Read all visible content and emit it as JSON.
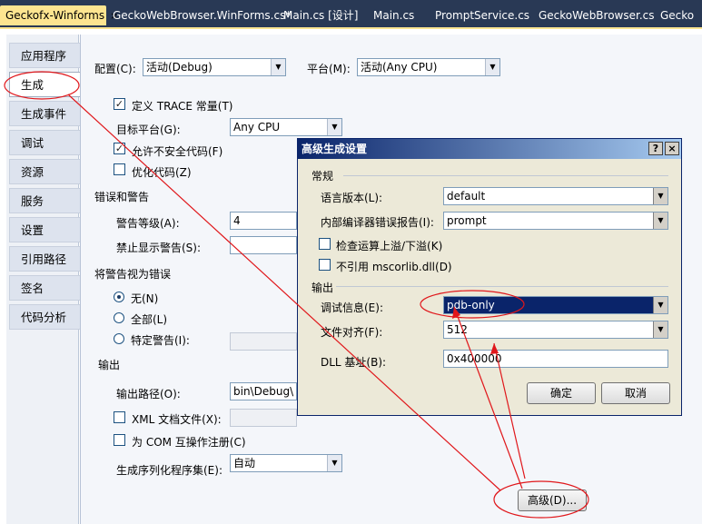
{
  "doc_tabs": [
    {
      "label": "Geckofx-Winforms",
      "active": true,
      "close": "×"
    },
    {
      "label": "GeckoWebBrowser.WinForms.cs*",
      "active": false
    },
    {
      "label": "Main.cs [设计]",
      "active": false
    },
    {
      "label": "Main.cs",
      "active": false
    },
    {
      "label": "PromptService.cs",
      "active": false
    },
    {
      "label": "GeckoWebBrowser.cs",
      "active": false
    },
    {
      "label": "Gecko",
      "active": false
    }
  ],
  "side_tabs": [
    "应用程序",
    "生成",
    "生成事件",
    "调试",
    "资源",
    "服务",
    "设置",
    "引用路径",
    "签名",
    "代码分析"
  ],
  "selected_side_tab": "生成",
  "top": {
    "config_label": "配置(C):",
    "config_value": "活动(Debug)",
    "platform_label": "平台(M):",
    "platform_value": "活动(Any CPU)"
  },
  "general": {
    "define_trace": "定义 TRACE 常量(T)",
    "define_trace_checked": true,
    "target_platform_label": "目标平台(G):",
    "target_platform_value": "Any CPU",
    "allow_unsafe": "允许不安全代码(F)",
    "allow_unsafe_checked": true,
    "optimize": "优化代码(Z)",
    "optimize_checked": false
  },
  "errors": {
    "header": "错误和警告",
    "warning_level_label": "警告等级(A):",
    "warning_level_value": "4",
    "suppress_label": "禁止显示警告(S):",
    "suppress_value": ""
  },
  "treat_warnings": {
    "header": "将警告视为错误",
    "none": "无(N)",
    "all": "全部(L)",
    "specific": "特定警告(I):",
    "selected": "none"
  },
  "output": {
    "header": "输出",
    "path_label": "输出路径(O):",
    "path_value": "bin\\Debug\\",
    "xml_doc": "XML 文档文件(X):",
    "xml_doc_checked": false,
    "com_register": "为 COM 互操作注册(C)",
    "com_register_checked": false,
    "serialization_label": "生成序列化程序集(E):",
    "serialization_value": "自动"
  },
  "advanced_button": "高级(D)...",
  "dialog": {
    "title": "高级生成设置",
    "help": "?",
    "close": "×",
    "general_header": "常规",
    "lang_version_label": "语言版本(L):",
    "lang_version_value": "default",
    "internal_error_label": "内部编译器错误报告(I):",
    "internal_error_value": "prompt",
    "check_overflow": "检查运算上溢/下溢(K)",
    "check_overflow_checked": false,
    "no_mscorlib": "不引用 mscorlib.dll(D)",
    "no_mscorlib_checked": false,
    "output_header": "输出",
    "debug_info_label": "调试信息(E):",
    "debug_info_value": "pdb-only",
    "file_align_label": "文件对齐(F):",
    "file_align_value": "512",
    "dll_base_label": "DLL 基址(B):",
    "dll_base_value": "0x400000",
    "ok_button": "确定",
    "cancel_button": "取消"
  },
  "annotation_color": "#e0171b"
}
